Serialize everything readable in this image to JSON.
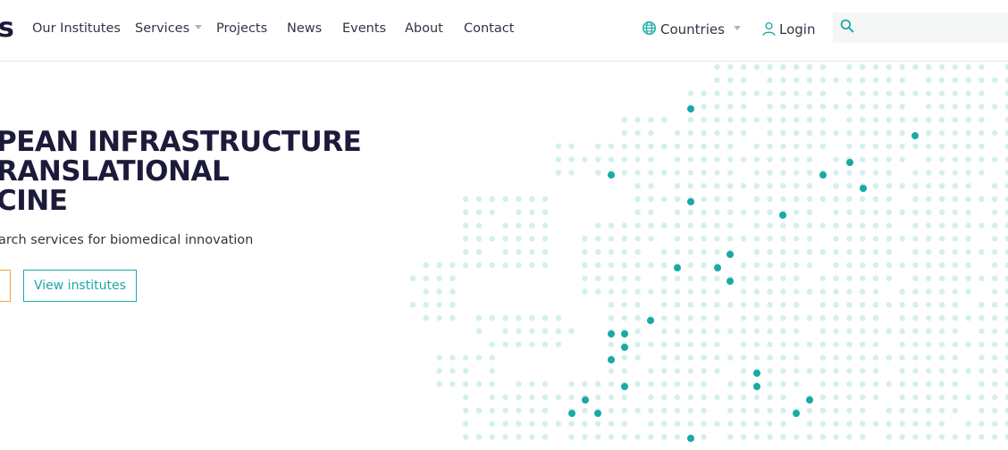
{
  "header": {
    "logo_text": "s",
    "nav": [
      {
        "label": "Our Institutes",
        "has_caret": false
      },
      {
        "label": "Services",
        "has_caret": true
      },
      {
        "label": "Projects",
        "has_caret": false
      },
      {
        "label": "News",
        "has_caret": false
      },
      {
        "label": "Events",
        "has_caret": false
      },
      {
        "label": "About",
        "has_caret": false
      },
      {
        "label": "Contact",
        "has_caret": false
      }
    ],
    "countries_label": "Countries",
    "login_label": "Login",
    "search": {
      "value": "",
      "placeholder": ""
    }
  },
  "hero": {
    "title_lines": [
      "PEAN INFRASTRUCTURE",
      "RANSLATIONAL",
      "CINE"
    ],
    "subtitle": "arch services for biomedical innovation",
    "view_institutes_label": "View institutes"
  },
  "colors": {
    "accent": "#1aa9a5",
    "dot_light": "#d4efed",
    "dark_text": "#1d1b3a",
    "orange": "#f0a23c"
  },
  "icons": {
    "countries": "globe-icon",
    "login": "user-icon",
    "search": "search-icon"
  }
}
